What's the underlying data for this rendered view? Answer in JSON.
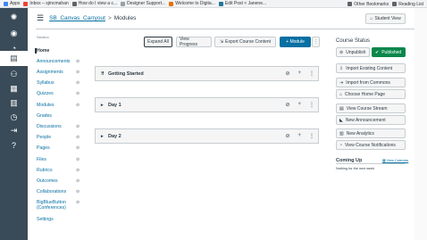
{
  "bookmarks": {
    "items": [
      {
        "label": "Apps",
        "color": "#4285f4"
      },
      {
        "label": "Inbox – sjmcmahan",
        "color": "#ea4335"
      },
      {
        "label": "How do I view a c...",
        "color": "#5f6368"
      },
      {
        "label": "Designer Support...",
        "color": "#9aa0a6"
      },
      {
        "label": "Welcome to Digita...",
        "color": "#e37400"
      },
      {
        "label": "Edit Post < Janene...",
        "color": "#21759b"
      }
    ],
    "other": "Other Bookmarks",
    "reading": "Reading List"
  },
  "header": {
    "course_link": "SB_Canvas_Carryout",
    "separator": ">",
    "page": "Modules",
    "student_view": "Student View"
  },
  "toolbar": {
    "expand_all": "Expand All",
    "view_progress": "View Progress",
    "export": "Export Course Content",
    "add_module": "+ Module",
    "more": "⋮"
  },
  "course_nav": {
    "label": "Sandbox",
    "items": [
      {
        "label": "Home",
        "hidden": false
      },
      {
        "label": "Announcements",
        "hidden": true
      },
      {
        "label": "Assignments",
        "hidden": true
      },
      {
        "label": "Syllabus",
        "hidden": true
      },
      {
        "label": "Quizzes",
        "hidden": true
      },
      {
        "label": "Modules",
        "hidden": true
      },
      {
        "label": "Grades",
        "hidden": false
      },
      {
        "label": "Discussions",
        "hidden": true
      },
      {
        "label": "People",
        "hidden": true
      },
      {
        "label": "Pages",
        "hidden": true
      },
      {
        "label": "Files",
        "hidden": true
      },
      {
        "label": "Rubrics",
        "hidden": true
      },
      {
        "label": "Outcomes",
        "hidden": true
      },
      {
        "label": "Collaborations",
        "hidden": true
      },
      {
        "label": "BigBlueButton (Conferences)",
        "hidden": true
      },
      {
        "label": "Settings",
        "hidden": false
      }
    ]
  },
  "modules": [
    {
      "title": "Getting Started",
      "toggle": "⠿"
    },
    {
      "title": "Day 1",
      "toggle": "▸"
    },
    {
      "title": "Day 2",
      "toggle": "▸"
    }
  ],
  "sidebar": {
    "status_title": "Course Status",
    "unpublish": "Unpublish",
    "published": "Published",
    "buttons": [
      {
        "label": "Import Existing Content",
        "icon": "import-icon"
      },
      {
        "label": "Import from Commons",
        "icon": "commons-icon"
      },
      {
        "label": "Choose Home Page",
        "icon": "home-icon"
      },
      {
        "label": "View Course Stream",
        "icon": "stream-icon"
      },
      {
        "label": "New Announcement",
        "icon": "megaphone-icon"
      },
      {
        "label": "New Analytics",
        "icon": "analytics-icon"
      },
      {
        "label": "View Course Notifications",
        "icon": "bell-icon"
      }
    ],
    "coming_up": "Coming Up",
    "view_calendar": "View Calendar",
    "nothing": "Nothing for the next week"
  },
  "colors": {
    "primary_button": "#0770a3",
    "published": "#0b874b",
    "global_nav": "#394b58",
    "link": "#0770a3"
  }
}
